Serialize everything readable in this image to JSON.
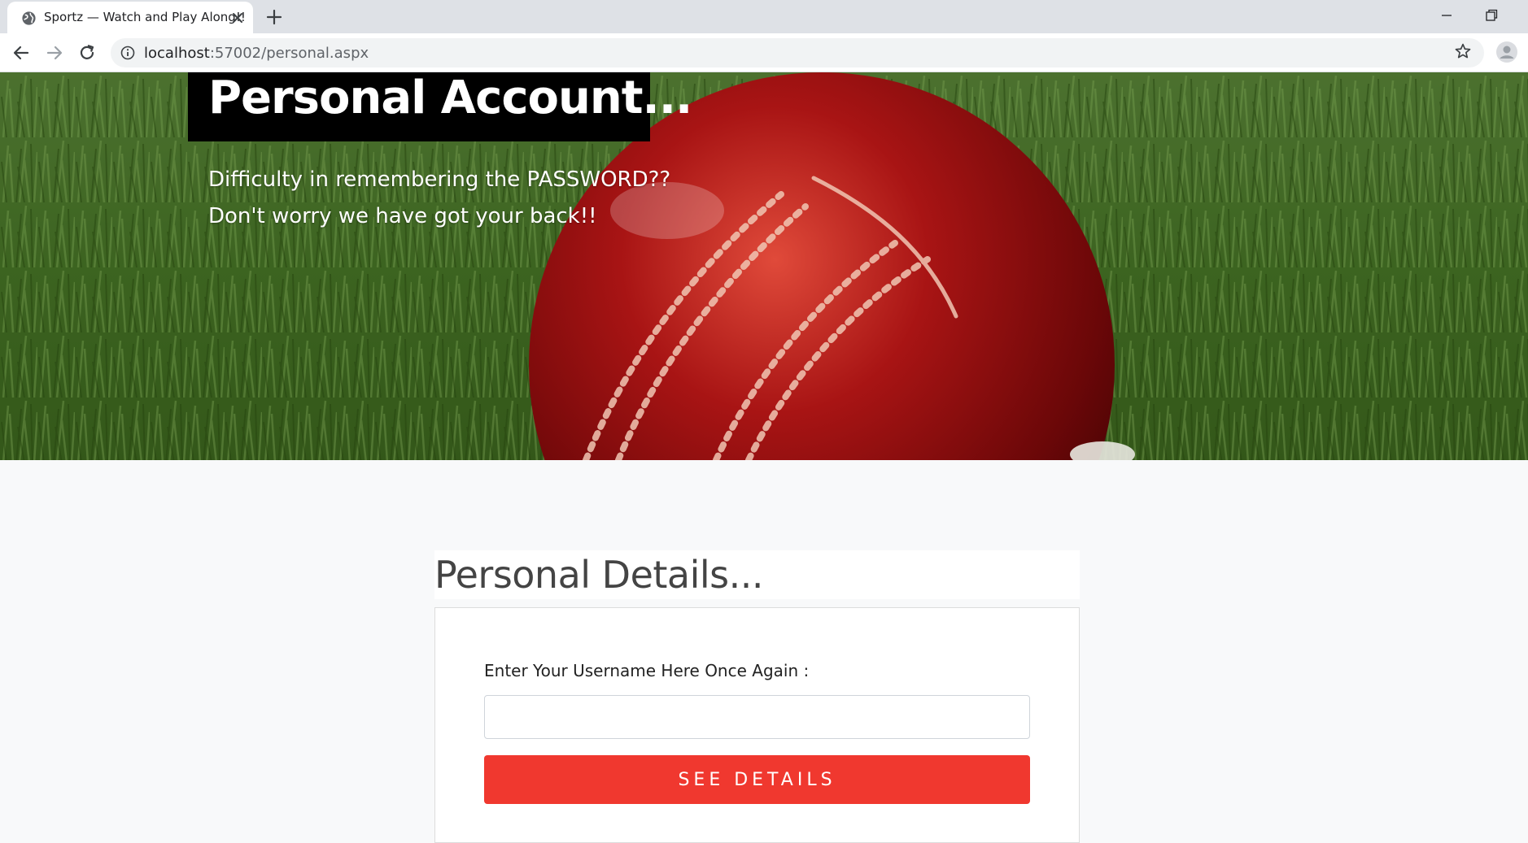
{
  "browser": {
    "tab_title": "Sportz — Watch and Play Along!!",
    "url_host": "localhost",
    "url_rest": ":57002/personal.aspx"
  },
  "icons": {
    "tab_favicon": "globe-icon",
    "tab_close": "close-icon",
    "new_tab": "plus-icon",
    "back": "arrow-left-icon",
    "forward": "arrow-right-icon",
    "reload": "reload-icon",
    "site_info": "info-icon",
    "bookmark": "star-icon",
    "profile": "profile-icon"
  },
  "hero": {
    "title": "Personal Account...",
    "subtitle": "Difficulty in remembering the PASSWORD?? Don't worry we have got your back!!"
  },
  "details": {
    "heading": "Personal Details...",
    "username_label": "Enter Your Username Here Once Again :",
    "username_value": "",
    "button_label": "SEE DETAILS"
  },
  "colors": {
    "accent_button": "#f0382f",
    "hero_title_bg": "#000000",
    "page_bg": "#f8f9fa"
  }
}
